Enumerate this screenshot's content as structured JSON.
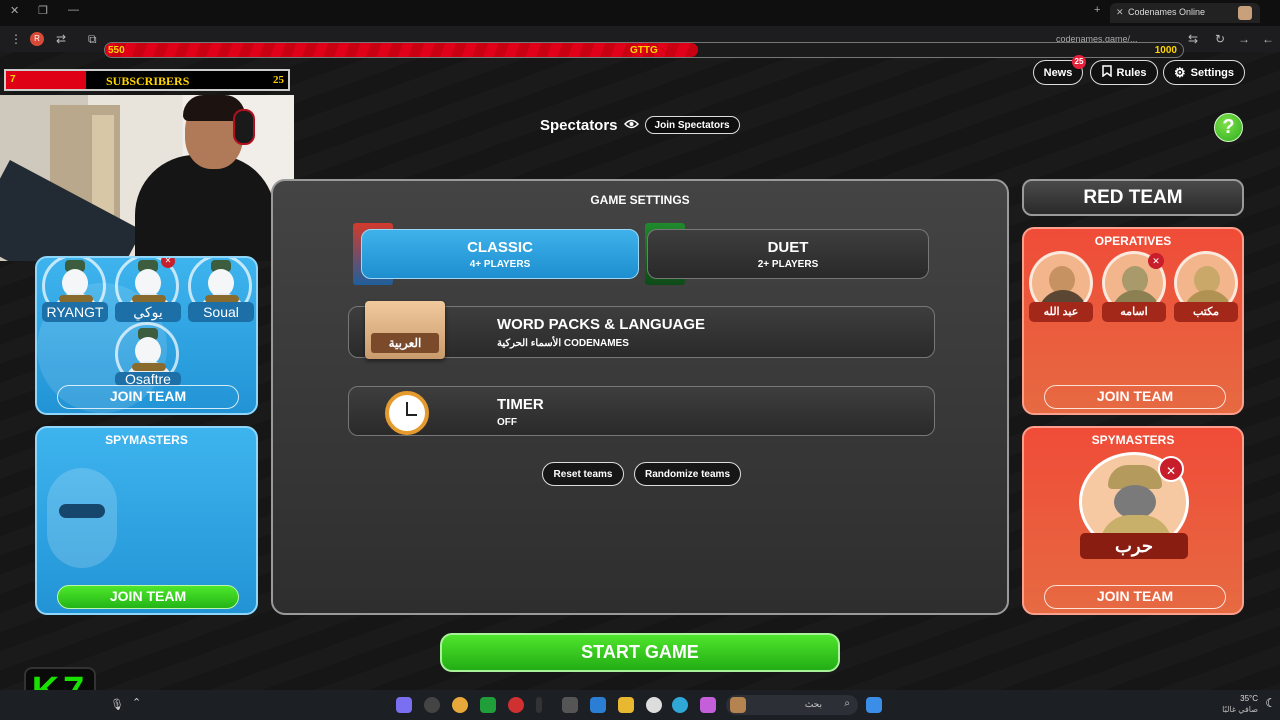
{
  "browser": {
    "tab_title": "Codenames Online",
    "url": "codenames.game/..."
  },
  "stream_overlay": {
    "bar_left": "550",
    "bar_mid": "GTTG",
    "bar_right": "1000",
    "bar_progress": 0.55,
    "subs_count": "7",
    "subs_label": "SUBSCRIBERS",
    "subs_goal": "25",
    "logo_text": "K7"
  },
  "header": {
    "news_label": "News",
    "news_badge": "25",
    "rules_label": "Rules",
    "settings_label": "Settings",
    "help_label": "?"
  },
  "spectators": {
    "title": "Spectators",
    "join_label": "Join Spectators"
  },
  "game_settings": {
    "title": "GAME SETTINGS",
    "classic_title": "CLASSIC",
    "classic_sub": "4+ PLAYERS",
    "duet_title": "DUET",
    "duet_sub": "2+ PLAYERS",
    "wordpacks_title": "WORD PACKS & LANGUAGE",
    "wordpacks_sub": "الأسماء الحركية CODENAMES",
    "wordpacks_badge": "العربية",
    "timer_title": "TIMER",
    "timer_sub": "OFF",
    "reset_label": "Reset teams",
    "randomize_label": "Randomize teams",
    "start_label": "START GAME"
  },
  "blue_team": {
    "operatives": [
      "RYANGT",
      "يوكي",
      "Soual",
      "Osaftre"
    ],
    "join_operatives": "JOIN TEAM",
    "spymasters_title": "SPYMASTERS",
    "join_spymasters": "JOIN TEAM"
  },
  "red_team": {
    "title": "RED TEAM",
    "operatives_title": "OPERATIVES",
    "operatives": [
      "عبد الله",
      "اسامه",
      "مكتب"
    ],
    "join_operatives": "JOIN TEAM",
    "spymasters_title": "SPYMASTERS",
    "spymaster_name": "حرب",
    "join_spymasters": "JOIN TEAM"
  },
  "taskbar": {
    "search_placeholder": "بحث",
    "weather": "35°C",
    "weather_sub": "صافي غالبًا"
  },
  "colors": {
    "blue_team": "#2294d6",
    "red_team": "#f04c38",
    "accent_green": "#2fae1e"
  }
}
